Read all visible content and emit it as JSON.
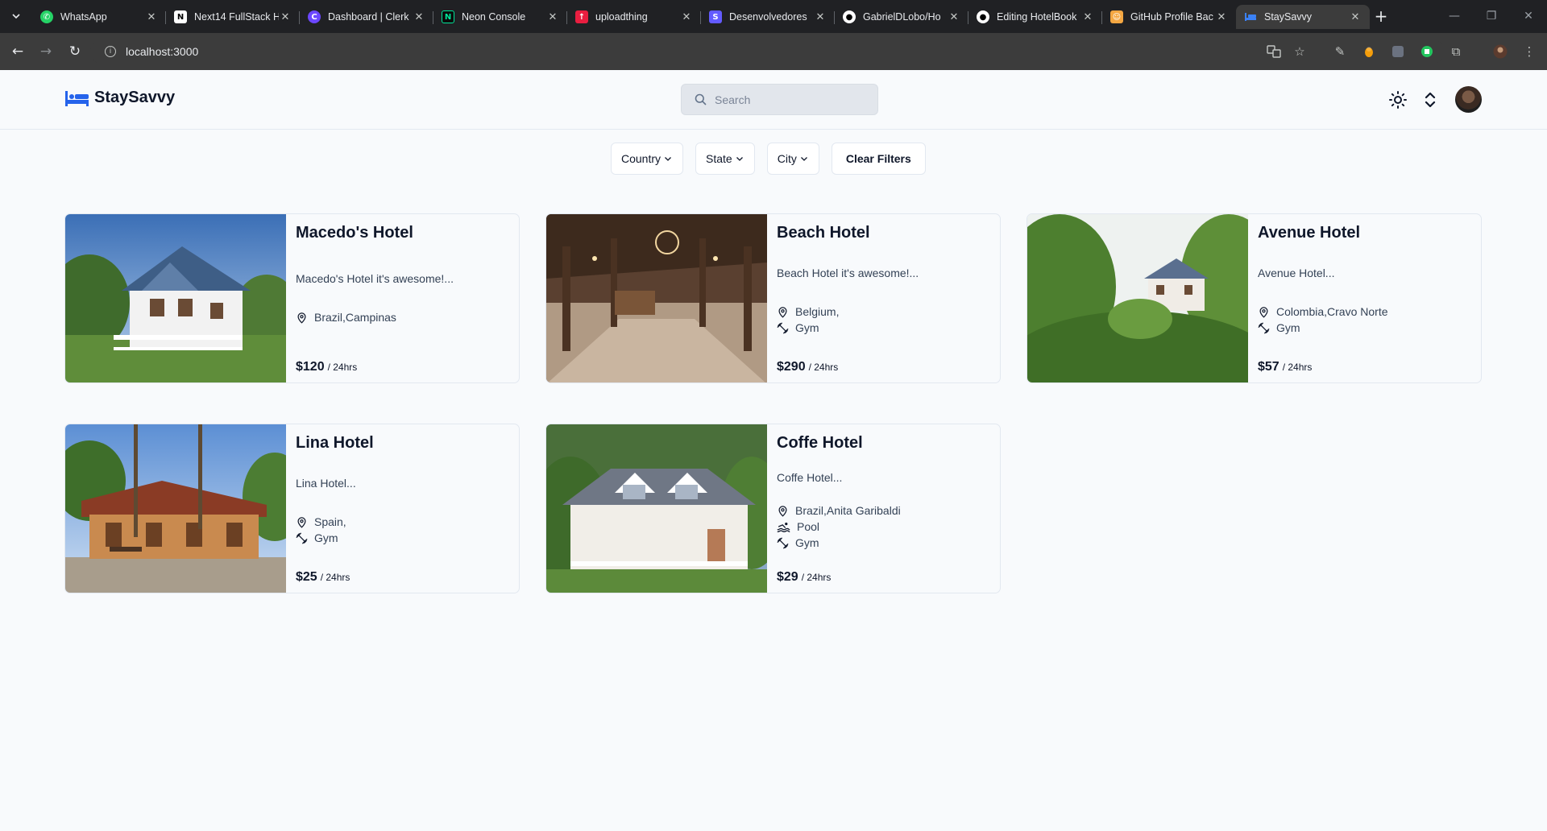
{
  "browser": {
    "tabs": [
      {
        "title": "WhatsApp",
        "icon": "whatsapp-icon",
        "color": "#25d366"
      },
      {
        "title": "Next14 FullStack H",
        "icon": "notion-icon",
        "color": "#ffffff"
      },
      {
        "title": "Dashboard | Clerk",
        "icon": "clerk-icon",
        "color": "#6c47ff"
      },
      {
        "title": "Neon Console",
        "icon": "neon-icon",
        "color": "#00e599"
      },
      {
        "title": "uploadthing",
        "icon": "uploadthing-icon",
        "color": "#e91e40"
      },
      {
        "title": "Desenvolvedores",
        "icon": "stripe-icon",
        "color": "#635bff"
      },
      {
        "title": "GabrielDLobo/Ho",
        "icon": "github-icon",
        "color": "#ffffff"
      },
      {
        "title": "Editing HotelBook",
        "icon": "github-icon",
        "color": "#ffffff"
      },
      {
        "title": "GitHub Profile Bac",
        "icon": "profile-icon",
        "color": "#f4a742"
      },
      {
        "title": "StaySavvy",
        "icon": "bed-icon",
        "color": "#3b82f6"
      }
    ],
    "url": "localhost:3000"
  },
  "app": {
    "brand": "StaySavvy",
    "search_placeholder": "Search",
    "filters": {
      "country": "Country",
      "state": "State",
      "city": "City",
      "clear": "Clear Filters"
    },
    "per_label": "/ 24hrs",
    "hotels": [
      {
        "name": "Macedo's Hotel",
        "description": "Macedo's Hotel it's awesome!...",
        "location": "Brazil,Campinas",
        "amenities": [],
        "price": "$120"
      },
      {
        "name": "Beach Hotel",
        "description": "Beach Hotel it's awesome!...",
        "location": "Belgium,",
        "amenities": [
          "Gym"
        ],
        "price": "$290"
      },
      {
        "name": "Avenue Hotel",
        "description": "Avenue Hotel...",
        "location": "Colombia,Cravo Norte",
        "amenities": [
          "Gym"
        ],
        "price": "$57"
      },
      {
        "name": "Lina Hotel",
        "description": "Lina Hotel...",
        "location": "Spain,",
        "amenities": [
          "Gym"
        ],
        "price": "$25"
      },
      {
        "name": "Coffe Hotel",
        "description": "Coffe Hotel...",
        "location": "Brazil,Anita Garibaldi",
        "amenities": [
          "Pool",
          "Gym"
        ],
        "price": "$29"
      }
    ]
  },
  "colors": {
    "accent": "#2563eb",
    "page_bg": "#f8fafc",
    "chrome_bg": "#202124",
    "toolbar_bg": "#3c3c3c"
  }
}
